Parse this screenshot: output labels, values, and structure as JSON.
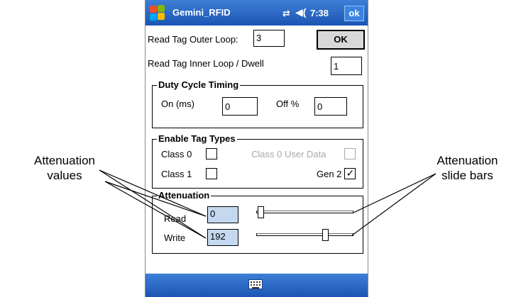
{
  "window": {
    "title": "Gemini_RFID",
    "time": "7:38",
    "ok_label": "ok"
  },
  "status_icons": {
    "connectivity": "connectivity-icon",
    "volume": "volume-icon"
  },
  "form": {
    "outer_loop": {
      "label": "Read Tag Outer Loop:",
      "value": "3"
    },
    "ok_button": "OK",
    "inner_loop": {
      "label": "Read Tag Inner Loop / Dwell",
      "value": "1"
    },
    "duty_cycle": {
      "title": "Duty Cycle Timing",
      "on_label": "On (ms)",
      "on_value": "0",
      "off_label": "Off %",
      "off_value": "0"
    },
    "tag_types": {
      "title": "Enable Tag Types",
      "items": [
        {
          "label": "Class 0",
          "checked": false,
          "enabled": true
        },
        {
          "label": "Class 0 User Data",
          "checked": false,
          "enabled": false
        },
        {
          "label": "Class 1",
          "checked": false,
          "enabled": true
        },
        {
          "label": "Gen 2",
          "checked": true,
          "enabled": true
        }
      ],
      "check_glyph": "✓"
    },
    "attenuation": {
      "title": "Attenuation",
      "read": {
        "label": "Read",
        "value": "0",
        "slider_fraction": 0.0
      },
      "write": {
        "label": "Write",
        "value": "192",
        "slider_fraction": 0.73
      }
    }
  },
  "annotations": {
    "values_line1": "Attenuation",
    "values_line2": "values",
    "slides_line1": "Attenuation",
    "slides_line2": "slide bars"
  },
  "colors": {
    "title_bar": "#2a6bd0",
    "attenuation_field": "#c4d9f0",
    "form_background": "#ffffff"
  }
}
